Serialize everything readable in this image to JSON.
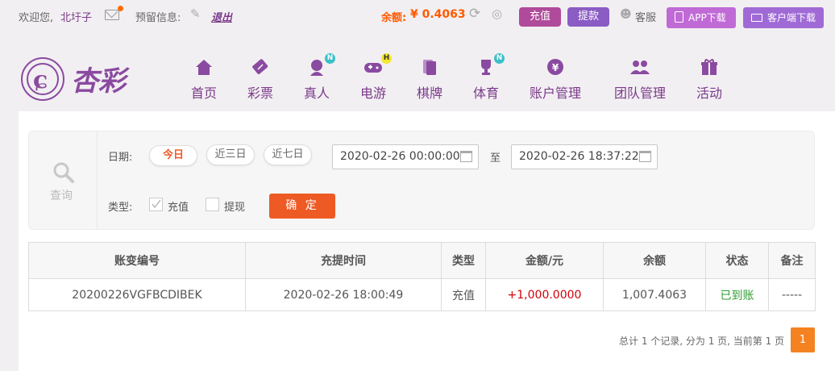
{
  "topbar": {
    "welcome_prefix": "欢迎您,",
    "username": "北圩子",
    "reserved_label": "预留信息:",
    "logout_label": "退出",
    "balance_label": "余额:",
    "balance_value": "¥ 0.4063",
    "recharge_label": "充值",
    "withdraw_label": "提款",
    "service_label": "客服",
    "app_download_label": "APP下载",
    "client_download_label": "客户端下载"
  },
  "header": {
    "brand": "杏彩",
    "nav": [
      {
        "label": "首页",
        "icon": "home-icon"
      },
      {
        "label": "彩票",
        "icon": "lottery-ticket-icon"
      },
      {
        "label": "真人",
        "icon": "live-dealer-icon",
        "badge": "N"
      },
      {
        "label": "电游",
        "icon": "gamepad-icon",
        "badge": "H"
      },
      {
        "label": "棋牌",
        "icon": "cards-icon"
      },
      {
        "label": "体育",
        "icon": "trophy-icon",
        "badge": "N"
      },
      {
        "label": "账户管理",
        "icon": "yuan-coin-icon"
      },
      {
        "label": "团队管理",
        "icon": "team-icon"
      },
      {
        "label": "活动",
        "icon": "gift-icon"
      }
    ]
  },
  "filter": {
    "query_label": "查询",
    "date_label": "日期:",
    "ranges": [
      "今日",
      "近三日",
      "近七日"
    ],
    "selected_range": "今日",
    "start_date": "2020-02-26 00:00:00",
    "to_label": "至",
    "end_date": "2020-02-26 18:37:22",
    "type_label": "类型:",
    "types": [
      {
        "label": "充值",
        "checked": true
      },
      {
        "label": "提现",
        "checked": false
      }
    ],
    "confirm_label": "确 定"
  },
  "table": {
    "headers": [
      "账变编号",
      "充提时间",
      "类型",
      "金额/元",
      "余额",
      "状态",
      "备注"
    ],
    "rows": [
      [
        "20200226VGFBCDIBEK",
        "2020-02-26 18:00:49",
        "充值",
        "+1,000.0000",
        "1,007.4063",
        "已到账",
        "-----"
      ]
    ]
  },
  "pagination": {
    "summary": "总计 1 个记录, 分为 1 页, 当前第 1 页",
    "current_page": "1"
  },
  "colors": {
    "brand_purple": "#8a4aa0",
    "recharge_bg": "#b04a9a",
    "withdraw_bg": "#8a5cc4",
    "app_bg": "#c06ad6",
    "client_bg": "#a06ad6",
    "balance_orange": "#ff5a00",
    "confirm_orange": "#ed5a24",
    "amount_red": "#d4000a",
    "status_green": "#2e9c2e",
    "page_orange": "#f58220"
  }
}
